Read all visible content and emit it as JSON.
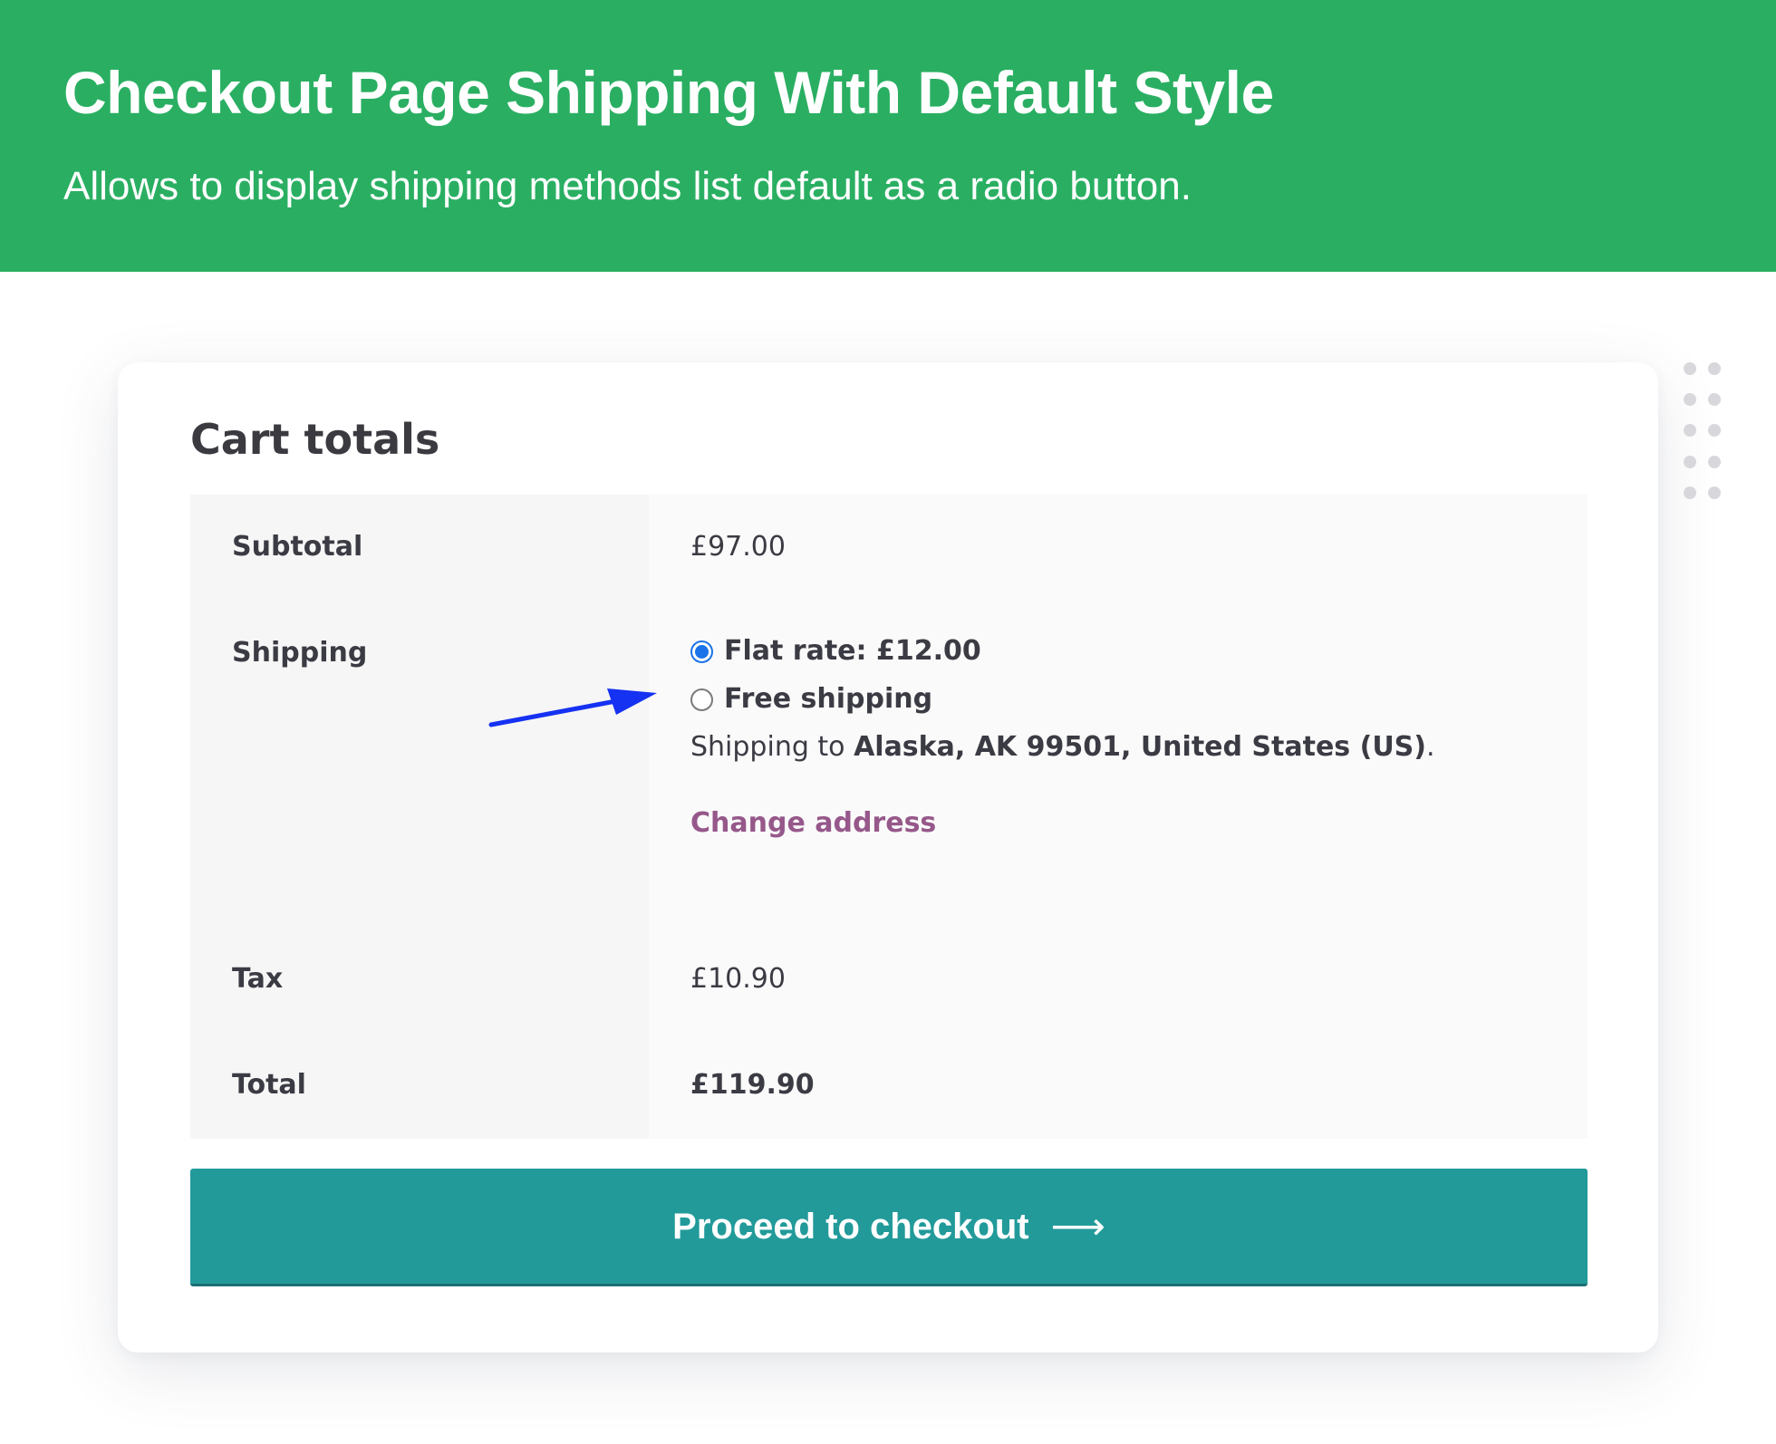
{
  "banner": {
    "title": "Checkout Page Shipping With Default Style",
    "subtitle": "Allows to display shipping methods list default as a radio button."
  },
  "cart": {
    "title": "Cart totals",
    "rows": {
      "subtotal": {
        "label": "Subtotal",
        "value": "£97.00"
      },
      "shipping": {
        "label": "Shipping",
        "options": [
          {
            "label": "Flat rate: £12.00",
            "selected": true
          },
          {
            "label": "Free shipping",
            "selected": false
          }
        ],
        "destination_prefix": "Shipping to ",
        "destination": "Alaska, AK 99501, United States (US)",
        "destination_suffix": ".",
        "change_address": "Change address"
      },
      "tax": {
        "label": "Tax",
        "value": "£10.90"
      },
      "total": {
        "label": "Total",
        "value": "£119.90"
      }
    },
    "checkout_button": {
      "label": "Proceed to checkout",
      "icon": "arrow-right-icon",
      "arrow": "⟶"
    }
  },
  "colors": {
    "banner": "#2aaf62",
    "checkout_button": "#229a9a",
    "link": "#96588a",
    "radio_selected": "#1a73e8",
    "annotation_arrow": "#1531f2"
  }
}
